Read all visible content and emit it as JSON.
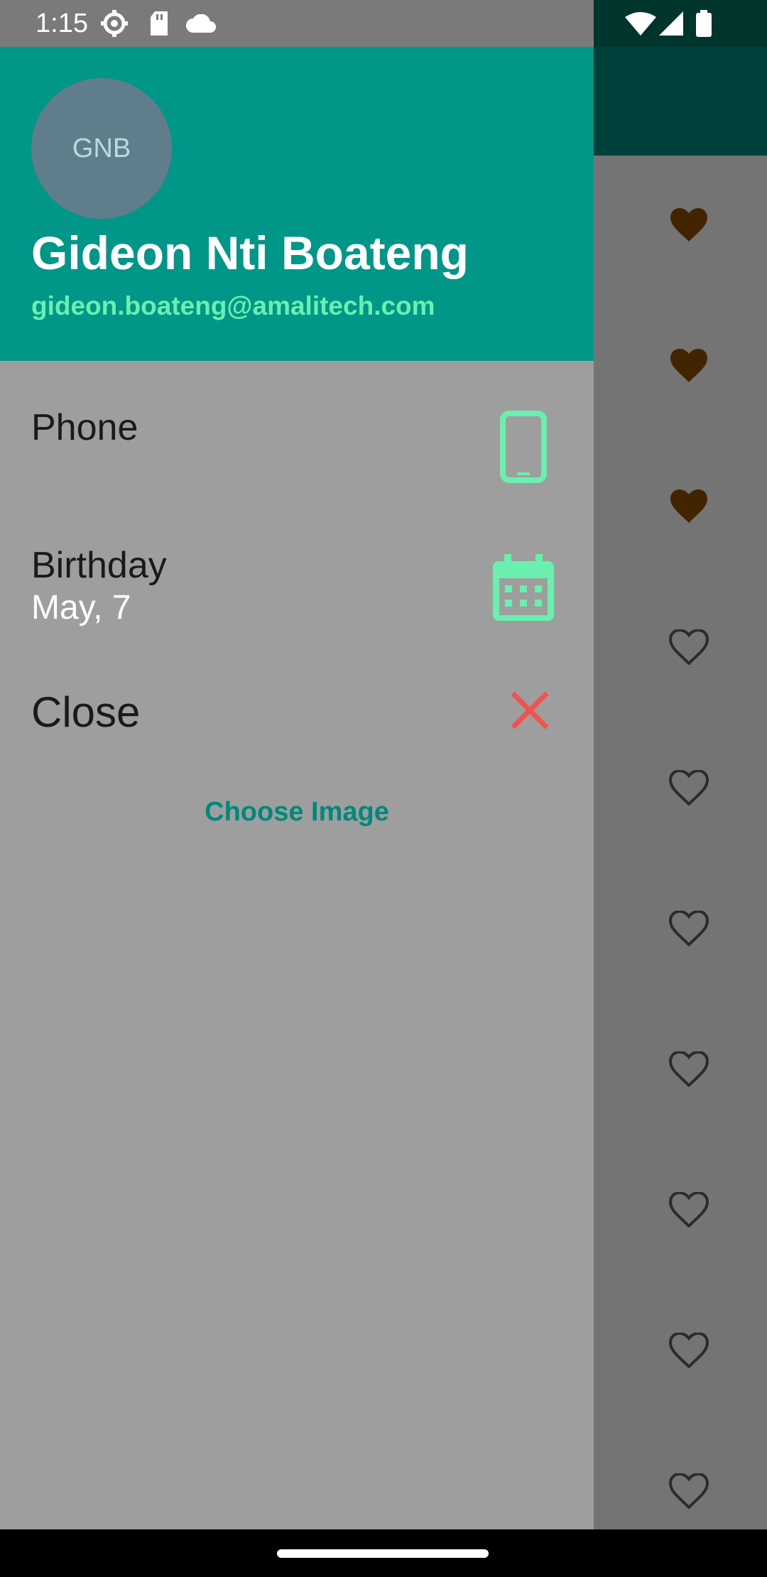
{
  "status_bar": {
    "time": "1:15",
    "icons": [
      "settings-icon",
      "sd-card-icon",
      "cloud-icon",
      "wifi-icon",
      "signal-icon",
      "battery-icon"
    ]
  },
  "background_list": {
    "favorite_states": [
      true,
      true,
      true,
      false,
      false,
      false,
      false,
      false,
      false,
      false
    ],
    "favorite_color": "#8a4b00"
  },
  "drawer": {
    "avatar_initials": "GNB",
    "user_name": "Gideon Nti Boateng",
    "user_email": "gideon.boateng@amalitech.com",
    "items": [
      {
        "title": "Phone",
        "subtitle": "",
        "icon": "smartphone-icon"
      },
      {
        "title": "Birthday",
        "subtitle": "May, 7",
        "icon": "calendar-icon"
      },
      {
        "title": "Close",
        "subtitle": "",
        "icon": "close-icon"
      }
    ],
    "choose_image_label": "Choose Image"
  },
  "colors": {
    "primary": "#009688",
    "accent": "#69f0ae",
    "close_icon": "#ef5350"
  }
}
